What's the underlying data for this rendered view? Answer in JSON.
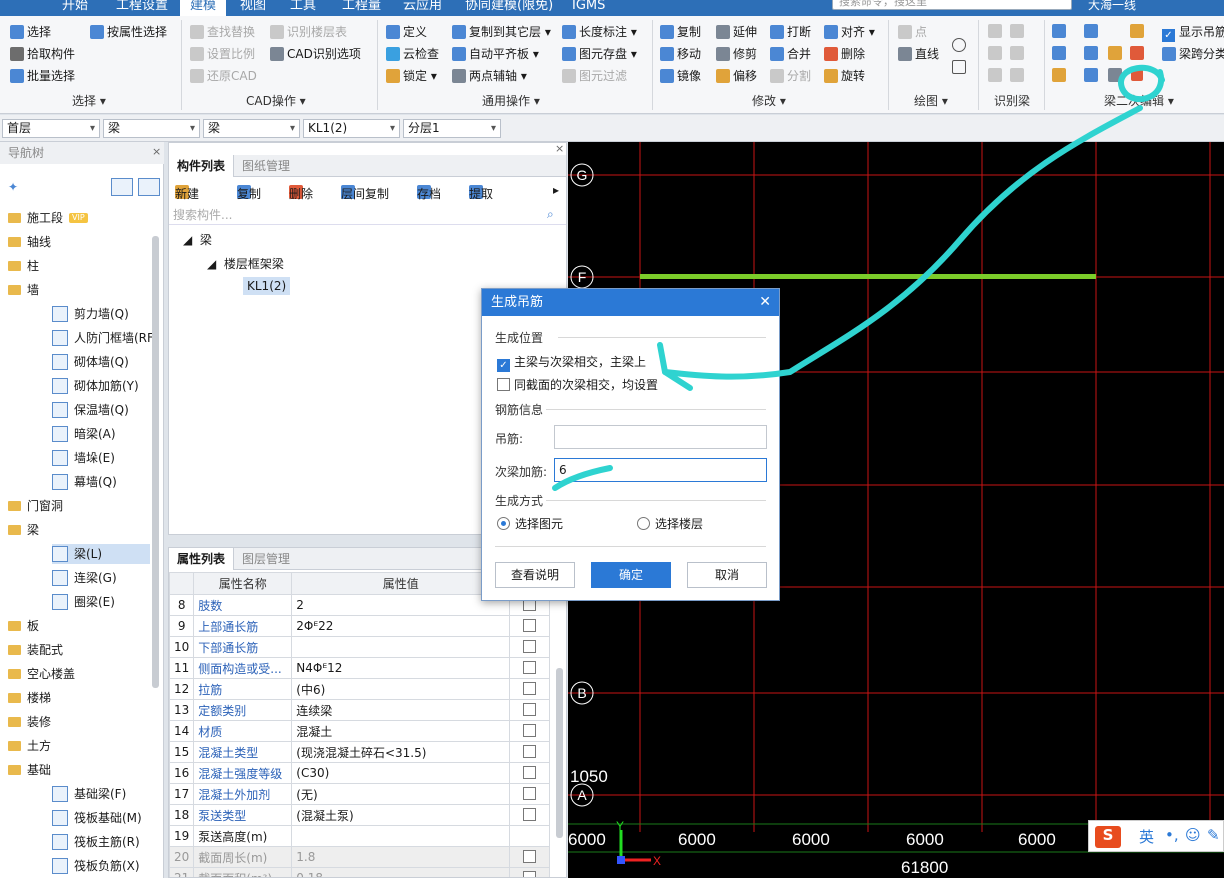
{
  "menu": {
    "tabs": [
      "开始",
      "工程设置",
      "建模",
      "视图",
      "工具",
      "工程量",
      "云应用",
      "协同建模(限免)",
      "IGMS"
    ],
    "active": "建模",
    "search_placeholder": "搜索命令，搜这里",
    "user": "大海一线"
  },
  "ribbon": {
    "select": {
      "items": [
        "选择",
        "按属性选择",
        "拾取构件",
        "批量选择"
      ],
      "label": "选择"
    },
    "cad": {
      "items": [
        "查找替换",
        "识别楼层表",
        "设置比例",
        "CAD识别选项",
        "还原CAD"
      ],
      "label": "CAD操作"
    },
    "common": {
      "items": [
        "定义",
        "复制到其它层",
        "长度标注",
        "云检查",
        "自动平齐板",
        "图元存盘",
        "锁定",
        "两点辅轴",
        "图元过滤"
      ],
      "label": "通用操作"
    },
    "modify": {
      "items": [
        "复制",
        "延伸",
        "打断",
        "对齐",
        "移动",
        "修剪",
        "合并",
        "删除",
        "镜像",
        "偏移",
        "分割",
        "旋转"
      ],
      "label": "修改"
    },
    "draw": {
      "items": [
        "点",
        "直线"
      ],
      "label": "绘图"
    },
    "identify": {
      "label": "识别梁"
    },
    "beam": {
      "items": [
        "显示吊筋",
        "梁跨分类"
      ],
      "label": "梁二次编辑"
    }
  },
  "selectors": [
    "首层",
    "梁",
    "梁",
    "KL1(2)",
    "分层1"
  ],
  "nav": {
    "title": "导航树",
    "vip": "VIP",
    "items": [
      {
        "label": "施工段",
        "type": "folder"
      },
      {
        "label": "轴线",
        "type": "folder"
      },
      {
        "label": "柱",
        "type": "folder"
      },
      {
        "label": "墙",
        "type": "folder"
      },
      {
        "label": "剪力墙(Q)",
        "type": "sub"
      },
      {
        "label": "人防门框墙(RF)",
        "type": "sub"
      },
      {
        "label": "砌体墙(Q)",
        "type": "sub"
      },
      {
        "label": "砌体加筋(Y)",
        "type": "sub"
      },
      {
        "label": "保温墙(Q)",
        "type": "sub"
      },
      {
        "label": "暗梁(A)",
        "type": "sub"
      },
      {
        "label": "墙垛(E)",
        "type": "sub"
      },
      {
        "label": "幕墙(Q)",
        "type": "sub"
      },
      {
        "label": "门窗洞",
        "type": "folder"
      },
      {
        "label": "梁",
        "type": "folder"
      },
      {
        "label": "梁(L)",
        "type": "sub"
      },
      {
        "label": "连梁(G)",
        "type": "sub"
      },
      {
        "label": "圈梁(E)",
        "type": "sub"
      },
      {
        "label": "板",
        "type": "folder"
      },
      {
        "label": "装配式",
        "type": "folder"
      },
      {
        "label": "空心楼盖",
        "type": "folder"
      },
      {
        "label": "楼梯",
        "type": "folder"
      },
      {
        "label": "装修",
        "type": "folder"
      },
      {
        "label": "土方",
        "type": "folder"
      },
      {
        "label": "基础",
        "type": "folder"
      },
      {
        "label": "基础梁(F)",
        "type": "sub"
      },
      {
        "label": "筏板基础(M)",
        "type": "sub"
      },
      {
        "label": "筏板主筋(R)",
        "type": "sub"
      },
      {
        "label": "筏板负筋(X)",
        "type": "sub"
      }
    ]
  },
  "components": {
    "tabs": [
      "构件列表",
      "图纸管理"
    ],
    "toolbar": [
      "新建",
      "复制",
      "删除",
      "层间复制",
      "存档",
      "提取"
    ],
    "search_placeholder": "搜索构件...",
    "tree": {
      "root": "梁",
      "child": "楼层框架梁",
      "leaf": "KL1(2)"
    }
  },
  "properties": {
    "tabs": [
      "属性列表",
      "图层管理"
    ],
    "headers": [
      "属性名称",
      "属性值"
    ],
    "rows": [
      {
        "n": "8",
        "name": "肢数",
        "value": "2"
      },
      {
        "n": "9",
        "name": "上部通长筋",
        "value": "2Φᴱ22"
      },
      {
        "n": "10",
        "name": "下部通长筋",
        "value": ""
      },
      {
        "n": "11",
        "name": "侧面构造或受...",
        "value": "N4Φᴱ12"
      },
      {
        "n": "12",
        "name": "拉筋",
        "value": "(中6)"
      },
      {
        "n": "13",
        "name": "定额类别",
        "value": "连续梁"
      },
      {
        "n": "14",
        "name": "材质",
        "value": "混凝土"
      },
      {
        "n": "15",
        "name": "混凝土类型",
        "value": "(现浇混凝土碎石<31.5)"
      },
      {
        "n": "16",
        "name": "混凝土强度等级",
        "value": "(C30)"
      },
      {
        "n": "17",
        "name": "混凝土外加剂",
        "value": "(无)"
      },
      {
        "n": "18",
        "name": "泵送类型",
        "value": "(混凝土泵)"
      },
      {
        "n": "19",
        "name": "泵送高度(m)",
        "value": ""
      },
      {
        "n": "20",
        "name": "截面周长(m)",
        "value": "1.8"
      },
      {
        "n": "21",
        "name": "截面面积(m²)",
        "value": "0.18"
      }
    ]
  },
  "canvas": {
    "axis_labels": [
      "G",
      "F",
      "B",
      "A"
    ],
    "dims": [
      "6000",
      "6000",
      "6000",
      "6000",
      "6000"
    ],
    "total": "61800",
    "offset": "1050",
    "x_label": "X",
    "y_label": "Y"
  },
  "dialog": {
    "title": "生成吊筋",
    "section_position": "生成位置",
    "opt_main_secondary": "主梁与次梁相交，主梁上",
    "opt_same_section": "同截面的次梁相交，均设置",
    "section_rebar": "钢筋信息",
    "label_hanger": "吊筋:",
    "hanger_value": "",
    "label_secondary": "次梁加筋:",
    "secondary_value": "6",
    "section_mode": "生成方式",
    "radio_element": "选择图元",
    "radio_floor": "选择楼层",
    "btn_help": "查看说明",
    "btn_ok": "确定",
    "btn_cancel": "取消"
  },
  "ime": {
    "lang": "英"
  },
  "colors": {
    "accent": "#2b79d6",
    "grid_red": "#d01010",
    "beam_green": "#7ccc2a",
    "annotation": "#2fd3d0"
  }
}
